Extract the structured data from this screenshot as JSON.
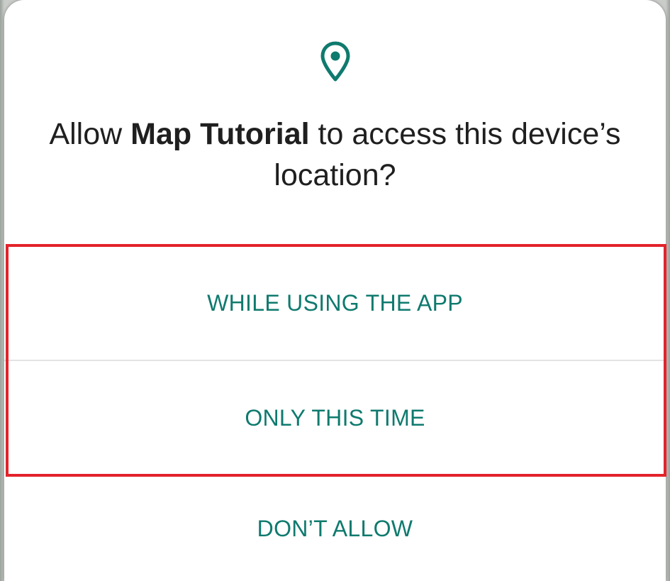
{
  "dialog": {
    "title_prefix": "Allow ",
    "app_name": "Map Tutorial",
    "title_suffix": " to access this device’s location?",
    "icon": "location-pin-icon",
    "options": [
      {
        "label": "WHILE USING THE APP"
      },
      {
        "label": "ONLY THIS TIME"
      },
      {
        "label": "DON’T ALLOW"
      }
    ],
    "highlight_color": "#e3222b",
    "accent_color": "#0f7a6e"
  }
}
